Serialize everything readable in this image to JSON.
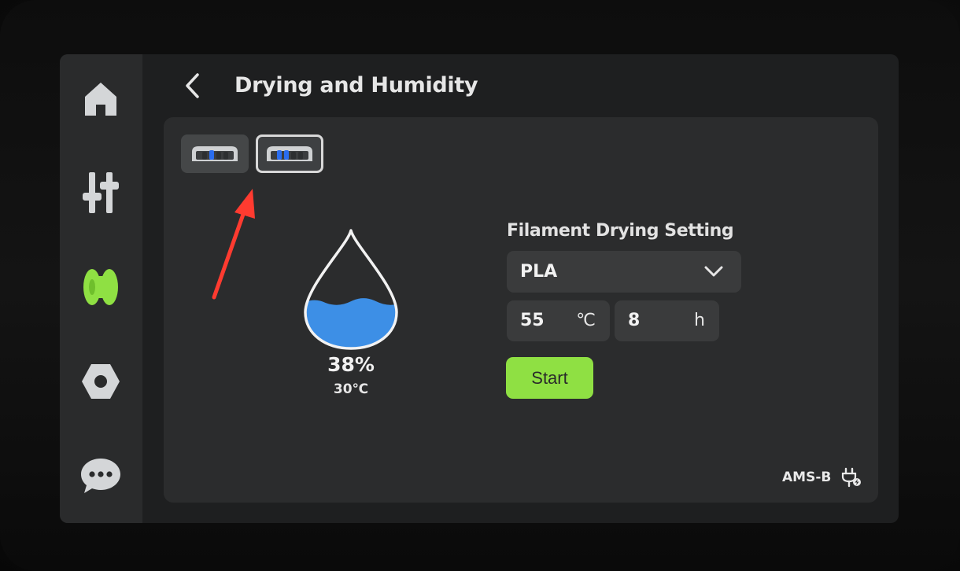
{
  "header": {
    "title": "Drying and Humidity"
  },
  "sidebar": {
    "items": [
      {
        "icon": "home-icon"
      },
      {
        "icon": "controls-icon"
      },
      {
        "icon": "filament-spool-icon",
        "active_color": "#8fe043"
      },
      {
        "icon": "settings-nut-icon"
      },
      {
        "icon": "chat-icon"
      }
    ]
  },
  "ams_units": [
    {
      "icon": "ams-unit-icon",
      "selected": false
    },
    {
      "icon": "ams-unit-icon",
      "selected": true
    }
  ],
  "status": {
    "humidity": "38%",
    "temperature": "30℃",
    "humidity_level": 0.38,
    "water_color": "#3d8fe6"
  },
  "drying": {
    "section_label": "Filament Drying Setting",
    "filament": "PLA",
    "temperature": "55",
    "temperature_unit": "℃",
    "duration": "8",
    "duration_unit": "h",
    "start_label": "Start",
    "accent": "#8fe043"
  },
  "device": {
    "label": "AMS-B",
    "icon": "plug-icon"
  }
}
